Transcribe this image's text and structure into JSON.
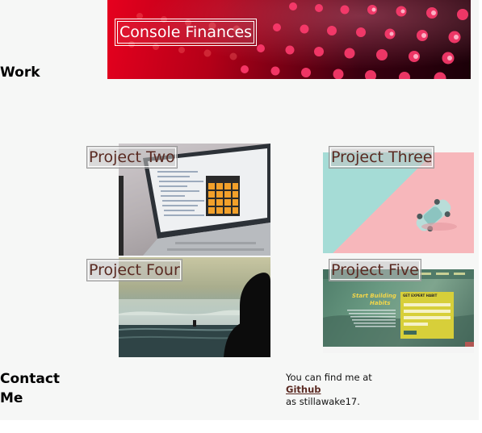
{
  "work": {
    "heading": "Work"
  },
  "projects": {
    "console_finances": "Console Finances",
    "project_two": "Project Two",
    "project_three": "Project Three",
    "project_four": "Project Four",
    "project_five": "Project Five"
  },
  "screens": {
    "five_headline_1": "Start Building",
    "five_headline_2": "Habits",
    "five_form_title": "GET EXPERT HABIT"
  },
  "contact": {
    "heading": "Contact Me",
    "line1": "You can find me at",
    "link_label": "Github",
    "line3": "as stillawake17."
  },
  "colors": {
    "page_background": "#f6f7f6",
    "label_text": "#5a2a22",
    "link": "#5a2a22"
  }
}
